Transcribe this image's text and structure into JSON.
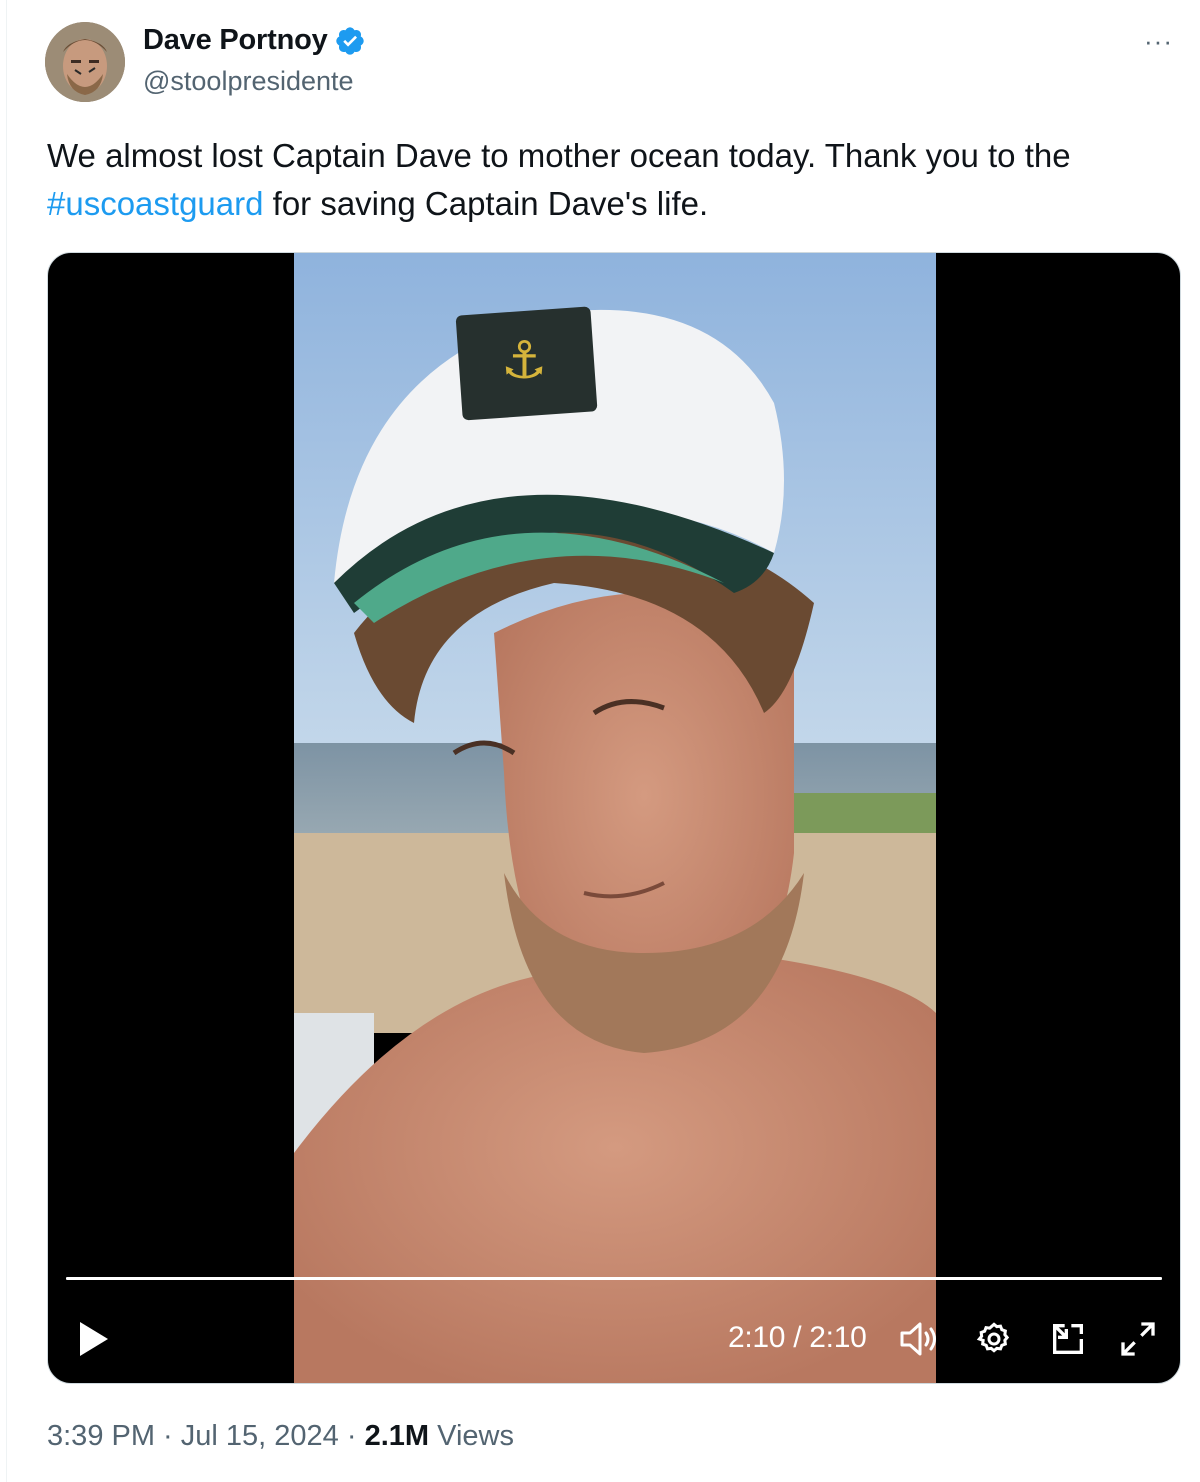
{
  "author": {
    "name": "Dave Portnoy",
    "handle": "@stoolpresidente",
    "verified": true,
    "verified_color": "#1d9bf0"
  },
  "more_menu": "···",
  "tweet": {
    "text_part1": "We almost lost Captain Dave to mother ocean today.  Thank you to the ",
    "hashtag": "#uscoastguard",
    "text_part2": " for saving Captain Dave's life."
  },
  "video": {
    "time_display": "2:10 / 2:10",
    "progress": 1.0,
    "controls": [
      "play-icon",
      "volume-icon",
      "settings-icon",
      "picture-in-picture-icon",
      "fullscreen-icon"
    ]
  },
  "meta": {
    "time": "3:39 PM",
    "separator": " · ",
    "date": "Jul 15, 2024",
    "views_count": "2.1M",
    "views_label": " Views"
  },
  "colors": {
    "text": "#0f1419",
    "secondary": "#536471",
    "link": "#1d9bf0"
  }
}
